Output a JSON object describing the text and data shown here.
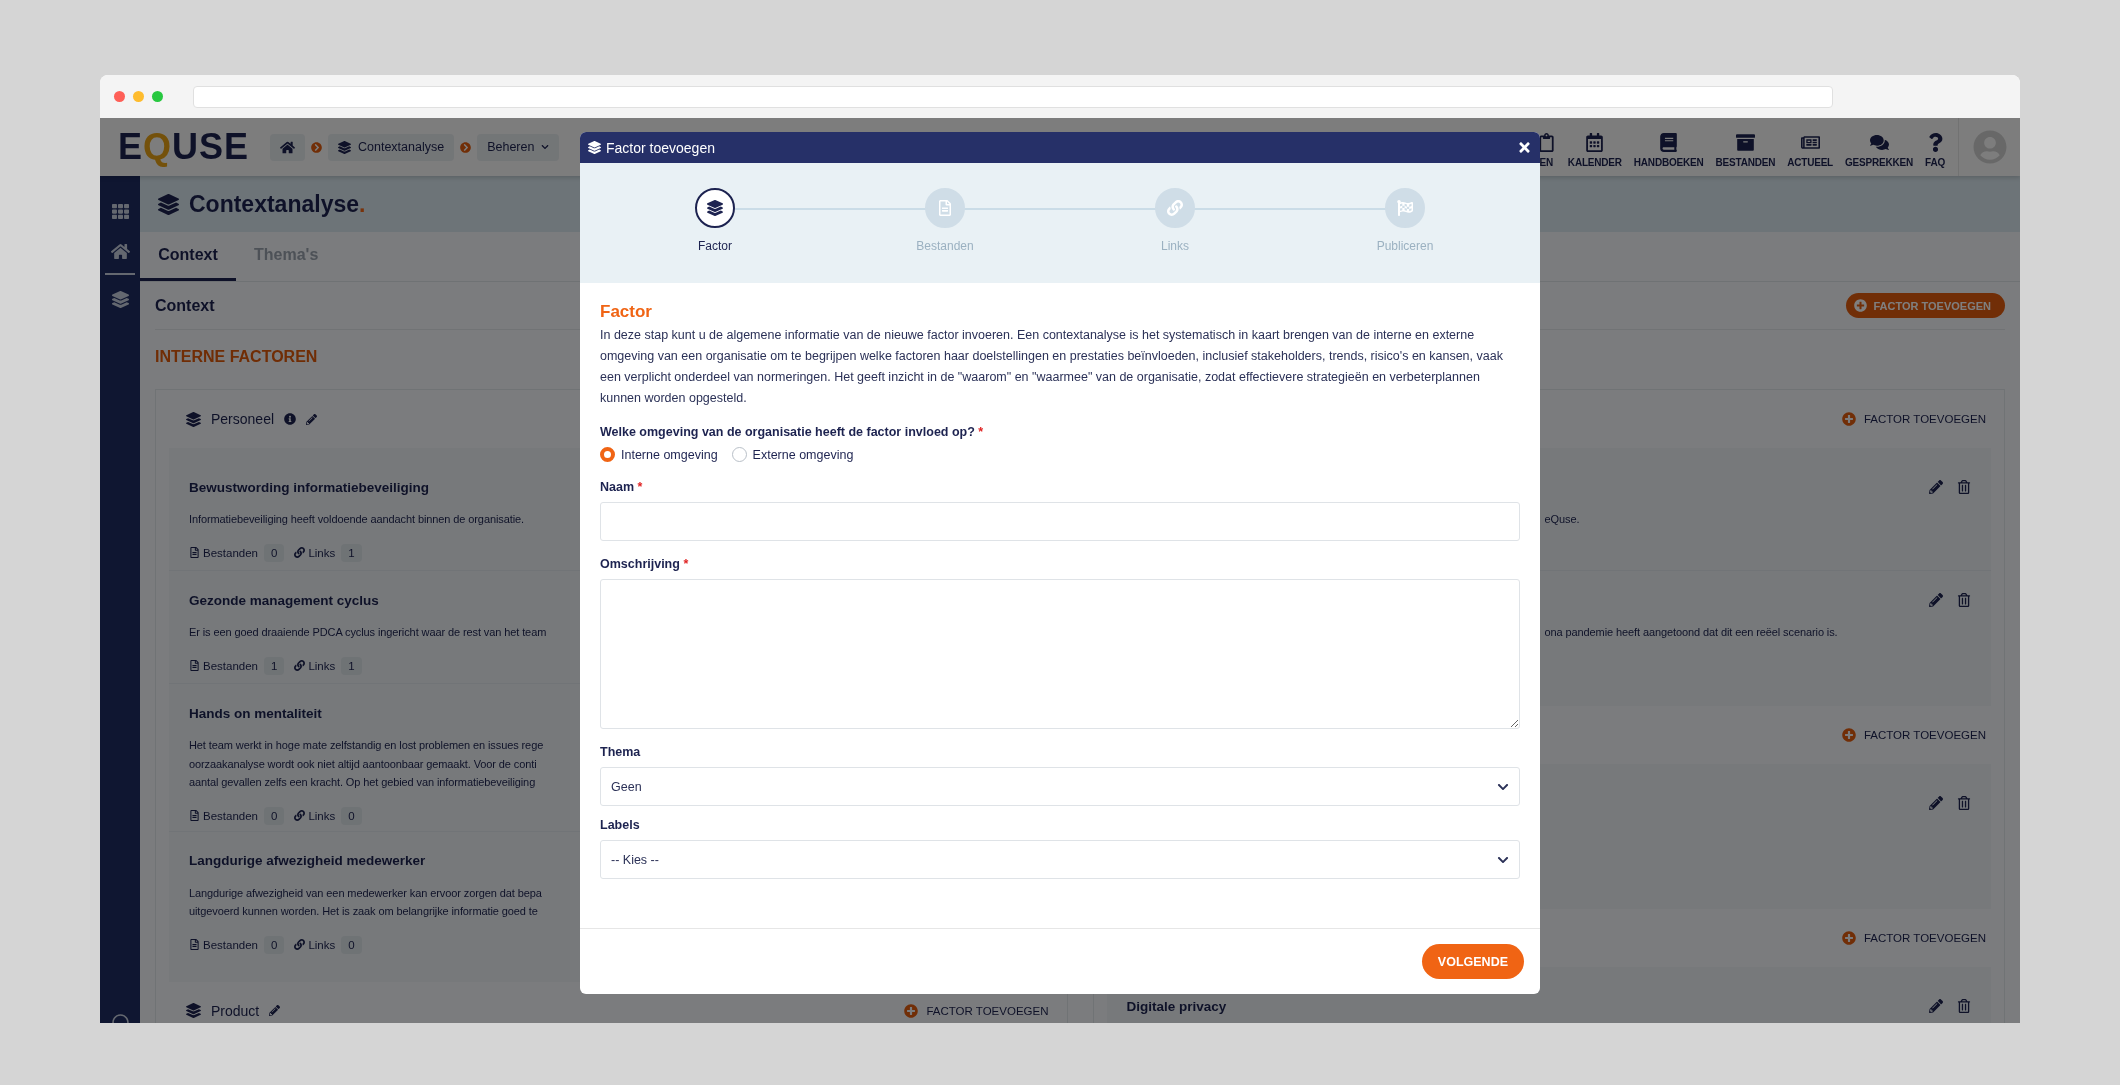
{
  "topbar": {
    "logo": {
      "start": "E",
      "accent": "Q",
      "end": "USE"
    },
    "breadcrumb": [
      {
        "kind": "home"
      },
      {
        "kind": "page",
        "label": "Contextanalyse"
      },
      {
        "kind": "menu",
        "label": "Beheren"
      }
    ],
    "nav": [
      {
        "kind": "clipboard",
        "label": "EN"
      },
      {
        "kind": "calendar",
        "label": "KALENDER"
      },
      {
        "kind": "book",
        "label": "HANDBOEKEN"
      },
      {
        "kind": "archive",
        "label": "BESTANDEN"
      },
      {
        "kind": "news",
        "label": "ACTUEEL"
      },
      {
        "kind": "chat",
        "label": "GESPREKKEN"
      },
      {
        "kind": "help",
        "label": "FAQ"
      }
    ]
  },
  "page": {
    "title": "Contextanalyse",
    "title_mark": ".",
    "tabs": [
      {
        "label": "Context",
        "selected": true
      },
      {
        "label": "Thema's",
        "selected": false
      }
    ]
  },
  "section": {
    "title": "Context",
    "add_button": "FACTOR TOEVOEGEN",
    "heading": "INTERNE FACTOREN"
  },
  "columns": [
    {
      "groups": [
        {
          "name": "Personeel",
          "info": true,
          "rename": true,
          "items": [
            {
              "title": "Bewustwording informatiebeveiliging",
              "description": [
                "Informatiebeveiliging heeft voldoende aandacht binnen de organisatie."
              ],
              "files_label": "Bestanden",
              "files": "0",
              "links_label": "Links",
              "links": "1"
            },
            {
              "title": "Gezonde management cyclus",
              "description": [
                "Er is een goed draaiende PDCA cyclus ingericht waar de rest van het team"
              ],
              "files_label": "Bestanden",
              "files": "1",
              "links_label": "Links",
              "links": "1"
            },
            {
              "title": "Hands on mentaliteit",
              "description": [
                "Het team werkt in hoge mate zelfstandig en lost problemen en issues rege",
                "oorzaakanalyse wordt ook niet altijd aantoonbaar gemaakt. Voor de conti",
                "aantal gevallen zelfs een kracht. Op het gebied van informatiebeveiliging"
              ],
              "files_label": "Bestanden",
              "files": "0",
              "links_label": "Links",
              "links": "0"
            },
            {
              "title": "Langdurige afwezigheid medewerker",
              "description": [
                "Langdurige afwezigheid van een medewerker kan ervoor zorgen dat bepa",
                "uitgevoerd kunnen worden. Het is zaak om belangrijke informatie goed te"
              ],
              "files_label": "Bestanden",
              "files": "0",
              "links_label": "Links",
              "links": "0"
            }
          ]
        },
        {
          "name": "Product",
          "rename": true,
          "add_label": "FACTOR TOEVOEGEN"
        }
      ]
    },
    {
      "groups": [
        {
          "add_label": "FACTOR TOEVOEGEN",
          "items": [
            {
              "description": [
                "eQuse."
              ],
              "editable": true
            },
            {
              "description": [
                "ona pandemie heeft aangetoond dat dit een reëel scenario is."
              ],
              "editable": true
            }
          ]
        },
        {
          "add_label": "FACTOR TOEVOEGEN",
          "items": [
            {
              "editable": true
            }
          ]
        },
        {
          "add_label": "FACTOR TOEVOEGEN",
          "items": [
            {
              "title": "Digitale privacy",
              "editable": true
            }
          ]
        }
      ]
    }
  ],
  "modal": {
    "title": "Factor toevoegen",
    "steps": [
      {
        "kind": "layers",
        "label": "Factor",
        "selected": true
      },
      {
        "kind": "file",
        "label": "Bestanden",
        "selected": false
      },
      {
        "kind": "link",
        "label": "Links",
        "selected": false
      },
      {
        "kind": "flag",
        "label": "Publiceren",
        "selected": false
      }
    ],
    "heading": "Factor",
    "intro": "In deze stap kunt u de algemene informatie van de nieuwe factor invoeren. Een contextanalyse is het systematisch in kaart brengen van de interne en externe omgeving van een organisatie om te begrijpen welke factoren haar doelstellingen en prestaties beïnvloeden, inclusief stakeholders, trends, risico's en kansen, vaak een verplicht onderdeel van normeringen. Het geeft inzicht in de \"waarom\" en \"waarmee\" van de organisatie, zodat effectievere strategieën en verbeterplannen kunnen worden opgesteld.",
    "question": {
      "label": "Welke omgeving van de organisatie heeft de factor invloed op?",
      "required_mark": "*",
      "options": [
        {
          "label": "Interne omgeving",
          "selected": true
        },
        {
          "label": "Externe omgeving",
          "selected": false
        }
      ]
    },
    "fields": [
      {
        "kind": "text",
        "label": "Naam",
        "required_mark": "*"
      },
      {
        "kind": "textarea",
        "label": "Omschrijving",
        "required_mark": "*"
      },
      {
        "kind": "select",
        "label": "Thema",
        "value": "Geen"
      },
      {
        "kind": "select",
        "label": "Labels",
        "value": "-- Kies --"
      }
    ],
    "next_button": "VOLGENDE"
  }
}
